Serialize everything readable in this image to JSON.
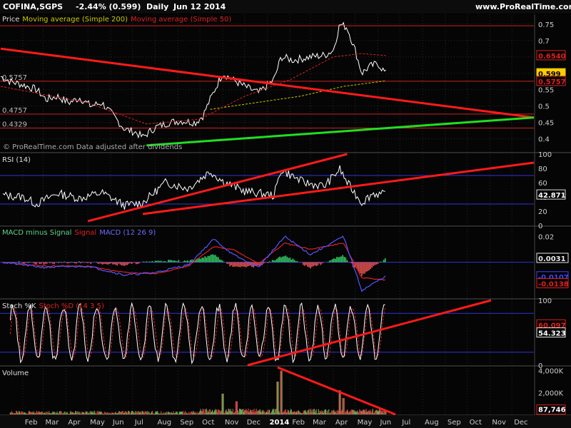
{
  "header": {
    "ticker": "COFINA,SGPS",
    "change": "-2.44% (0.599)",
    "period": "Daily",
    "date": "Jun 12 2014",
    "site": "www.ProRealTime.com",
    "watermark": "© ProRealTime.com  Data adjusted after dividends"
  },
  "colors": {
    "background": "#000000",
    "grid": "#2a2a2a",
    "price_line": "#ffffff",
    "ma200": "#c9c900",
    "ma50": "#e02020",
    "trend_red": "#ff1a1a",
    "trend_green": "#22dd22",
    "hline": "#cc2222",
    "ref_line": "#3333dd",
    "macd_pos": "#33cc66",
    "macd_neg": "#ee5555",
    "volume": "#cc4444"
  },
  "chart_data": [
    {
      "type": "line",
      "title": "Price",
      "legend": [
        "Moving average (Simple 200)",
        "Moving average (Simple 50)"
      ],
      "ylim": [
        0.36,
        0.78
      ],
      "y_ticks": [
        0.4,
        0.45,
        0.5,
        0.55,
        0.6,
        0.65,
        0.7,
        0.75
      ],
      "level_labels": [
        "0.5757",
        "0.4757",
        "0.4329"
      ],
      "level_values": [
        0.5757,
        0.4757,
        0.4329
      ],
      "price_badges": [
        {
          "label": "0.6540",
          "value": 0.654,
          "color": "#e02020"
        },
        {
          "label": "0.599",
          "value": 0.599,
          "color": "#ffcc00"
        },
        {
          "label": "0.5757",
          "value": 0.5757,
          "color": "#e02020"
        }
      ],
      "partial_label": "0.55",
      "series_points": [
        [
          "2013-01-02",
          0.59
        ],
        [
          "2013-01-15",
          0.575
        ],
        [
          "2013-02-01",
          0.565
        ],
        [
          "2013-02-20",
          0.55
        ],
        [
          "2013-03-05",
          0.52
        ],
        [
          "2013-03-20",
          0.53
        ],
        [
          "2013-04-05",
          0.51
        ],
        [
          "2013-04-20",
          0.525
        ],
        [
          "2013-05-05",
          0.5
        ],
        [
          "2013-05-20",
          0.51
        ],
        [
          "2013-06-05",
          0.47
        ],
        [
          "2013-06-20",
          0.43
        ],
        [
          "2013-07-05",
          0.42
        ],
        [
          "2013-07-15",
          0.405
        ],
        [
          "2013-08-01",
          0.435
        ],
        [
          "2013-08-20",
          0.45
        ],
        [
          "2013-09-05",
          0.455
        ],
        [
          "2013-09-25",
          0.45
        ],
        [
          "2013-10-05",
          0.47
        ],
        [
          "2013-10-15",
          0.52
        ],
        [
          "2013-11-01",
          0.6
        ],
        [
          "2013-11-15",
          0.58
        ],
        [
          "2013-12-01",
          0.56
        ],
        [
          "2013-12-20",
          0.54
        ],
        [
          "2014-01-10",
          0.58
        ],
        [
          "2014-01-20",
          0.65
        ],
        [
          "2014-02-05",
          0.64
        ],
        [
          "2014-03-01",
          0.65
        ],
        [
          "2014-03-20",
          0.655
        ],
        [
          "2014-04-01",
          0.67
        ],
        [
          "2014-04-10",
          0.75
        ],
        [
          "2014-04-20",
          0.74
        ],
        [
          "2014-05-01",
          0.67
        ],
        [
          "2014-05-10",
          0.6
        ],
        [
          "2014-05-20",
          0.62
        ],
        [
          "2014-06-01",
          0.63
        ],
        [
          "2014-06-12",
          0.599
        ]
      ],
      "ma200": [
        [
          "2013-10-15",
          0.49
        ],
        [
          "2013-12-15",
          0.51
        ],
        [
          "2014-02-15",
          0.53
        ],
        [
          "2014-04-15",
          0.56
        ],
        [
          "2014-06-12",
          0.577
        ]
      ],
      "ma50": [
        [
          "2013-01-02",
          0.56
        ],
        [
          "2013-05-01",
          0.51
        ],
        [
          "2013-07-20",
          0.445
        ],
        [
          "2013-10-01",
          0.46
        ],
        [
          "2013-12-01",
          0.53
        ],
        [
          "2014-02-01",
          0.58
        ],
        [
          "2014-04-01",
          0.65
        ],
        [
          "2014-05-10",
          0.66
        ],
        [
          "2014-06-12",
          0.654
        ]
      ],
      "trendlines": [
        {
          "color": "red",
          "from": [
            "2013-01-02",
            0.675
          ],
          "to": [
            "2014-12-31",
            0.465
          ]
        },
        {
          "color": "green",
          "from": [
            "2013-07-20",
            0.38
          ],
          "to": [
            "2014-12-31",
            0.465
          ]
        }
      ]
    },
    {
      "type": "line",
      "title": "RSI (14)",
      "ylim": [
        0,
        100
      ],
      "y_ticks": [
        0,
        20,
        40,
        60,
        80,
        100
      ],
      "ref_levels": [
        30,
        70
      ],
      "last_label": "42.871",
      "last_value": 42.871,
      "series_points": [
        [
          "2013-01-05",
          42
        ],
        [
          "2013-02-01",
          40
        ],
        [
          "2013-02-20",
          30
        ],
        [
          "2013-03-20",
          45
        ],
        [
          "2013-04-20",
          38
        ],
        [
          "2013-05-20",
          46
        ],
        [
          "2013-06-20",
          28
        ],
        [
          "2013-07-15",
          32
        ],
        [
          "2013-08-15",
          60
        ],
        [
          "2013-09-15",
          52
        ],
        [
          "2013-10-15",
          76
        ],
        [
          "2013-11-01",
          62
        ],
        [
          "2013-12-01",
          48
        ],
        [
          "2014-01-10",
          42
        ],
        [
          "2014-01-20",
          78
        ],
        [
          "2014-02-20",
          60
        ],
        [
          "2014-03-20",
          55
        ],
        [
          "2014-04-10",
          79
        ],
        [
          "2014-04-20",
          60
        ],
        [
          "2014-05-10",
          32
        ],
        [
          "2014-05-25",
          45
        ],
        [
          "2014-06-12",
          42.871
        ]
      ],
      "trendlines": [
        {
          "from": [
            "2013-05-01",
            6
          ],
          "to": [
            "2014-04-20",
            100
          ]
        },
        {
          "from": [
            "2013-07-15",
            16
          ],
          "to": [
            "2014-12-31",
            88
          ]
        }
      ]
    },
    {
      "type": "bar",
      "title": "MACD minus Signal",
      "legend": [
        "Signal",
        "MACD (12 26 9)"
      ],
      "ylim": [
        -0.028,
        0.027
      ],
      "y_ticks": [
        0.02
      ],
      "zero_label": "0",
      "value_labels": [
        {
          "label": "0.0031",
          "value": 0.0031,
          "color": "#e8e8e8"
        },
        {
          "label": "-0.0107",
          "value": -0.0107,
          "color": "#4444ff"
        },
        {
          "label": "-0.0138",
          "value": -0.0138,
          "color": "#e02020"
        }
      ],
      "macd": [
        [
          "2013-01-05",
          0.0
        ],
        [
          "2013-03-01",
          -0.004
        ],
        [
          "2013-05-01",
          -0.003
        ],
        [
          "2013-06-20",
          -0.01
        ],
        [
          "2013-08-01",
          -0.008
        ],
        [
          "2013-09-15",
          -0.002
        ],
        [
          "2013-10-20",
          0.018
        ],
        [
          "2013-11-15",
          0.006
        ],
        [
          "2013-12-20",
          -0.004
        ],
        [
          "2014-01-25",
          0.02
        ],
        [
          "2014-03-01",
          0.006
        ],
        [
          "2014-04-15",
          0.02
        ],
        [
          "2014-05-10",
          -0.022
        ],
        [
          "2014-06-12",
          -0.0107
        ]
      ],
      "signal": [
        [
          "2013-01-05",
          0.0
        ],
        [
          "2013-03-01",
          -0.003
        ],
        [
          "2013-05-01",
          -0.003
        ],
        [
          "2013-06-20",
          -0.008
        ],
        [
          "2013-08-01",
          -0.009
        ],
        [
          "2013-09-15",
          -0.003
        ],
        [
          "2013-10-20",
          0.012
        ],
        [
          "2013-11-15",
          0.01
        ],
        [
          "2013-12-20",
          -0.001
        ],
        [
          "2014-01-25",
          0.015
        ],
        [
          "2014-03-01",
          0.01
        ],
        [
          "2014-04-15",
          0.015
        ],
        [
          "2014-05-10",
          -0.012
        ],
        [
          "2014-06-12",
          -0.0138
        ]
      ]
    },
    {
      "type": "line",
      "title": "Stoch %K",
      "legend": [
        "Stoch %D (14 3 5)"
      ],
      "ylim": [
        0,
        100
      ],
      "y_ticks": [
        0,
        100
      ],
      "ref_levels": [
        20,
        80
      ],
      "last_labels": [
        {
          "label": "60.097",
          "value": 60.097,
          "color": "#e02020"
        },
        {
          "label": "54.323",
          "value": 54.323,
          "color": "#e8e8e8"
        }
      ],
      "trendline": {
        "from": [
          "2013-12-05",
          0
        ],
        "to": [
          "2014-12-31",
          100
        ]
      }
    },
    {
      "type": "bar",
      "title": "Volume",
      "ylim": [
        0,
        4300000
      ],
      "y_ticks": [
        2000000,
        4000000
      ],
      "y_tick_labels": [
        "2,000K",
        "4,000K"
      ],
      "last_label": "87,746",
      "last_value": 87746,
      "spikes": [
        [
          "2013-11-01",
          1900000
        ],
        [
          "2013-11-20",
          1200000
        ],
        [
          "2014-01-15",
          3000000
        ],
        [
          "2014-01-20",
          4000000
        ],
        [
          "2014-04-10",
          2200000
        ],
        [
          "2014-04-15",
          1500000
        ]
      ],
      "trendline": {
        "from": [
          "2014-01-15",
          4300000
        ],
        "to": [
          "2014-06-25",
          0
        ]
      }
    }
  ],
  "x_axis": {
    "months": [
      {
        "label": "Feb",
        "date": "2013-02-01"
      },
      {
        "label": "Mar",
        "date": "2013-03-01"
      },
      {
        "label": "Apr",
        "date": "2013-04-01"
      },
      {
        "label": "May",
        "date": "2013-05-01"
      },
      {
        "label": "Jun",
        "date": "2013-06-01"
      },
      {
        "label": "Jul",
        "date": "2013-07-01"
      },
      {
        "label": "Aug",
        "date": "2013-08-01"
      },
      {
        "label": "Sep",
        "date": "2013-09-01"
      },
      {
        "label": "Oct",
        "date": "2013-10-01"
      },
      {
        "label": "Nov",
        "date": "2013-11-01"
      },
      {
        "label": "Dec",
        "date": "2013-12-01"
      },
      {
        "label": "2014",
        "date": "2014-01-01",
        "bold": true
      },
      {
        "label": "Feb",
        "date": "2014-02-01"
      },
      {
        "label": "Mar",
        "date": "2014-03-01"
      },
      {
        "label": "Apr",
        "date": "2014-04-01"
      },
      {
        "label": "May",
        "date": "2014-05-01"
      },
      {
        "label": "Jun",
        "date": "2014-06-01"
      },
      {
        "label": "Jul",
        "date": "2014-07-01"
      },
      {
        "label": "Aug",
        "date": "2014-08-01"
      },
      {
        "label": "Sep",
        "date": "2014-09-01"
      },
      {
        "label": "Oct",
        "date": "2014-10-01"
      },
      {
        "label": "Nov",
        "date": "2014-11-01"
      },
      {
        "label": "Dec",
        "date": "2014-12-01"
      }
    ],
    "range": [
      "2013-01-01",
      "2014-12-31"
    ]
  }
}
